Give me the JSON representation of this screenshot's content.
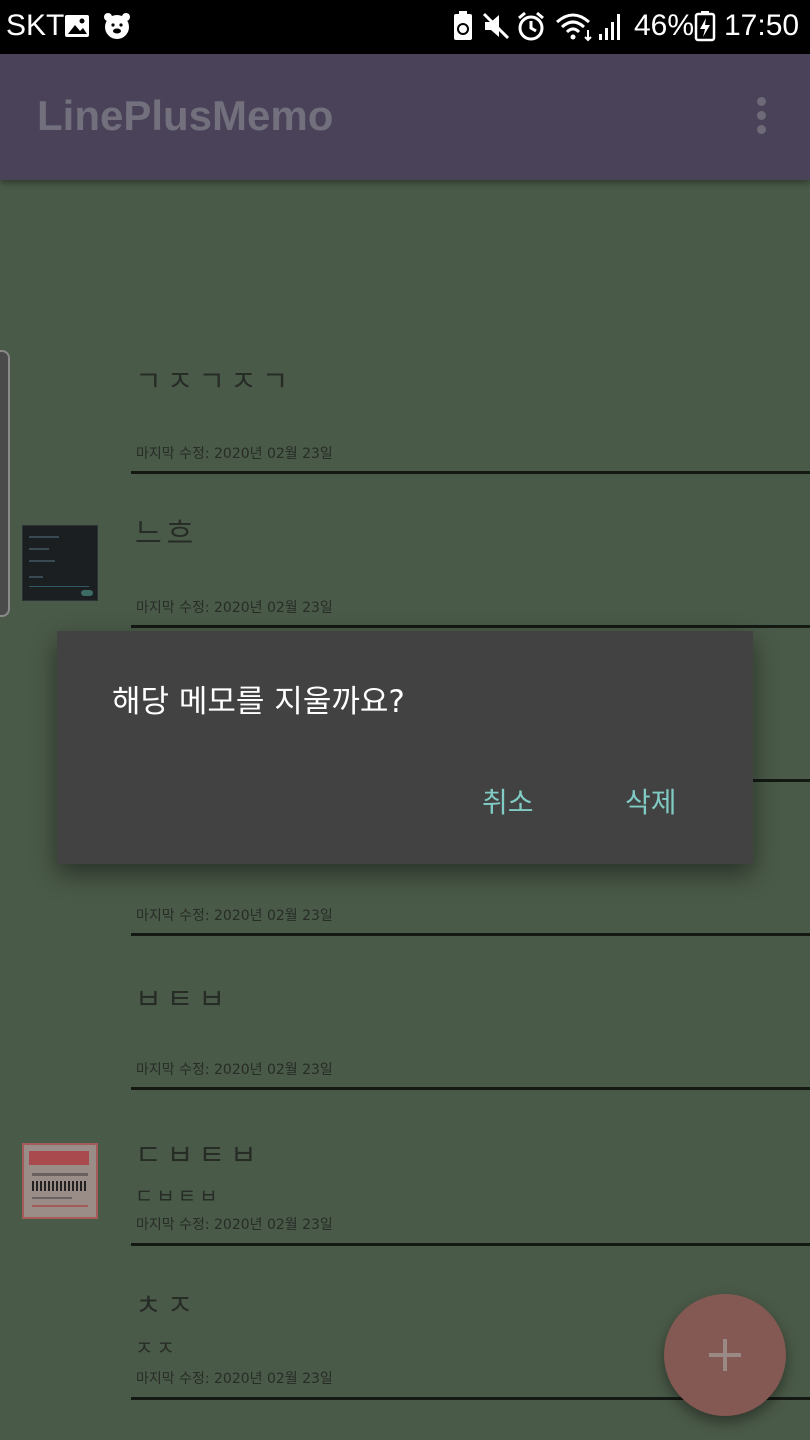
{
  "status_bar": {
    "carrier": "SKT",
    "battery": "46%",
    "time": "17:50",
    "icons": [
      "image-icon",
      "bear-icon",
      "battery-saver-icon",
      "mute-icon",
      "alarm-icon",
      "wifi-icon",
      "signal-icon",
      "battery-charging-icon"
    ]
  },
  "app_bar": {
    "title": "LinePlusMemo",
    "menu_icon": "overflow-menu-icon"
  },
  "memos": [
    {
      "title": "ㄱㅈㄱㅈㄱ",
      "preview": "",
      "date": "마지막 수정: 2020년 02월 23일",
      "thumbnail": "none"
    },
    {
      "title": "느흐",
      "preview": "",
      "date": "마지막 수정: 2020년 02월 23일",
      "thumbnail": "dark-screenshot"
    },
    {
      "title": "",
      "preview": "",
      "date": "마지막 수정: 2020년 02월 23일",
      "thumbnail": "none"
    },
    {
      "title": "ㅂㅌㅂ",
      "preview": "",
      "date": "마지막 수정: 2020년 02월 23일",
      "thumbnail": "none"
    },
    {
      "title": "ㄷㅂㅌㅂ",
      "preview": "ㄷㅂㅌㅂ",
      "date": "마지막 수정: 2020년 02월 23일",
      "thumbnail": "receipt-photo"
    },
    {
      "title": "ㅊㅈ",
      "preview": "ㅈㅈ",
      "date": "마지막 수정: 2020년 02월 23일",
      "thumbnail": "none"
    }
  ],
  "dialog": {
    "message": "해당 메모를 지울까요?",
    "cancel": "취소",
    "delete": "삭제",
    "button_color": "#80cbc4"
  },
  "fab": {
    "icon": "plus-icon",
    "color": "#845853"
  }
}
